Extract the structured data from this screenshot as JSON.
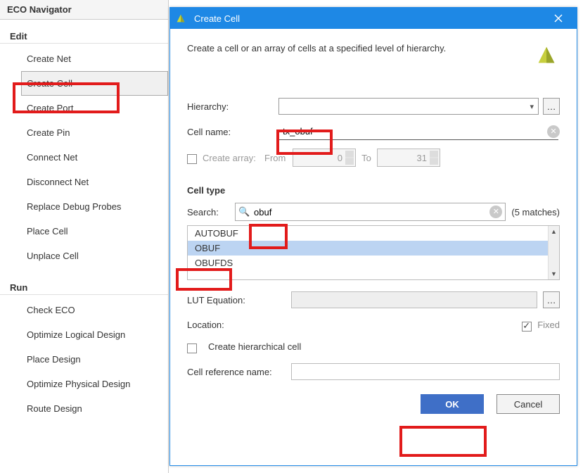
{
  "panel": {
    "title": "ECO Navigator",
    "sections": [
      {
        "header": "Edit",
        "items": [
          {
            "label": "Create Net"
          },
          {
            "label": "Create Cell",
            "selected": true
          },
          {
            "label": "Create Port"
          },
          {
            "label": "Create Pin"
          },
          {
            "label": "Connect Net"
          },
          {
            "label": "Disconnect Net"
          },
          {
            "label": "Replace Debug Probes"
          },
          {
            "label": "Place Cell"
          },
          {
            "label": "Unplace Cell"
          }
        ]
      },
      {
        "header": "Run",
        "items": [
          {
            "label": "Check ECO"
          },
          {
            "label": "Optimize Logical Design"
          },
          {
            "label": "Place Design"
          },
          {
            "label": "Optimize Physical Design"
          },
          {
            "label": "Route Design"
          }
        ]
      }
    ]
  },
  "dialog": {
    "title": "Create Cell",
    "description": "Create a cell or an array of cells at a specified level of hierarchy.",
    "hierarchy_label": "Hierarchy:",
    "hierarchy_value": "",
    "cellname_label": "Cell name:",
    "cellname_value": "tx_obuf",
    "createarray_label": "Create array:",
    "from_label": "From",
    "from_value": "0",
    "to_label": "To",
    "to_value": "31",
    "createarray_checked": false,
    "celltype_header": "Cell type",
    "search_label": "Search:",
    "search_value": "obuf",
    "search_matches": "(5 matches)",
    "results": [
      {
        "label": "AUTOBUF",
        "selected": false
      },
      {
        "label": "OBUF",
        "selected": true
      },
      {
        "label": "OBUFDS",
        "selected": false
      }
    ],
    "lut_label": "LUT Equation:",
    "location_label": "Location:",
    "fixed_label": "Fixed",
    "fixed_checked": true,
    "chc_label": "Create hierarchical cell",
    "chc_checked": false,
    "crn_label": "Cell reference name:",
    "ok_label": "OK",
    "cancel_label": "Cancel"
  }
}
